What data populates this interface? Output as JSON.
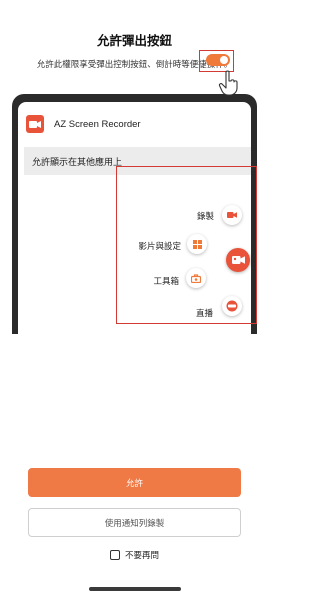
{
  "title": "允許彈出按鈕",
  "subtitle": "允許此權限享受彈出控制按鈕、倒計時等便捷操作。",
  "app": {
    "name": "AZ Screen Recorder"
  },
  "permission": {
    "label": "允許顯示在其他應用上",
    "enabled": true
  },
  "floating_menu": {
    "items": [
      {
        "label": "錄製",
        "icon": "record-camera-icon"
      },
      {
        "label": "影片與設定",
        "icon": "grid-icon"
      },
      {
        "label": "工具箱",
        "icon": "toolbox-icon"
      },
      {
        "label": "直播",
        "icon": "live-icon"
      }
    ],
    "main_icon": "camera-fab-icon"
  },
  "buttons": {
    "allow": "允許",
    "notification": "使用通知列錄製"
  },
  "dont_ask_again": {
    "label": "不要再問",
    "checked": false
  },
  "colors": {
    "accent": "#f07a45",
    "highlight": "#d43a34",
    "icon_red": "#e8533a"
  }
}
